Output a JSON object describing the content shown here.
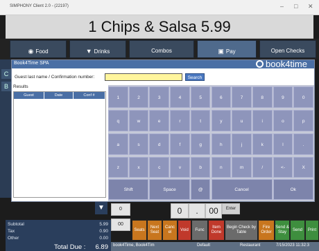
{
  "window": {
    "title": "SIMPHONY Client 2.0 - (22197)"
  },
  "order": {
    "line": "1 Chips & Salsa 5.99"
  },
  "tabs": [
    {
      "label": "Food",
      "icon": "burger-icon"
    },
    {
      "label": "Drinks",
      "icon": "glass-icon"
    },
    {
      "label": "Combos",
      "icon": ""
    },
    {
      "label": "Pay",
      "icon": "register-icon"
    },
    {
      "label": "Open Checks",
      "icon": ""
    }
  ],
  "dialog": {
    "title": "Book4Time SPA",
    "logo_text": "book4time",
    "guest_label": "Guest last name / Confirmation number:",
    "guest_value": "",
    "search_label": "Search",
    "results_label": "Results",
    "columns": [
      "Guest",
      "Date",
      "Conf #"
    ]
  },
  "keyboard": {
    "row1": [
      "1",
      "2",
      "3",
      "4",
      "5",
      "6",
      "7",
      "8",
      "9",
      "0"
    ],
    "row2": [
      "q",
      "w",
      "e",
      "r",
      "t",
      "y",
      "u",
      "i",
      "o",
      "p"
    ],
    "row3": [
      "a",
      "s",
      "d",
      "f",
      "g",
      "h",
      "j",
      "k",
      "l",
      "."
    ],
    "row4": [
      "z",
      "x",
      "c",
      "v",
      "b",
      "n",
      "m",
      "/",
      "<-",
      "X"
    ],
    "row5": [
      "Shift",
      "Space",
      "@",
      "Cancel",
      "Ok"
    ]
  },
  "totals": {
    "subtotal_label": "Subtotal",
    "subtotal": "5.99",
    "tax_label": "Tax",
    "tax": "0.90",
    "other_label": "Other",
    "other": "0.00",
    "total_due_label": "Total Due :",
    "total_due": "6.89"
  },
  "numpad": {
    "field1": "0",
    "field2": "00",
    "field3": "0",
    "field4": ".",
    "field5": "00",
    "enter_label": "Enter"
  },
  "actions": [
    {
      "label": "Seats",
      "color": "#c8761e"
    },
    {
      "label": "Next Seat",
      "color": "#c8761e"
    },
    {
      "label": "Canc el",
      "color": "#c8761e"
    },
    {
      "label": "Void",
      "color": "#c0392b"
    },
    {
      "label": "Func",
      "color": "#6b6b6b"
    },
    {
      "label": "Item Done",
      "color": "#c0392b"
    },
    {
      "label": "Begin Check by Table",
      "color": "#6b6b6b"
    },
    {
      "label": "Fire Order",
      "color": "#c8761e"
    },
    {
      "label": "Send & Stay",
      "color": "#3e8e3e"
    },
    {
      "label": "Send",
      "color": "#3e8e3e"
    },
    {
      "label": "Print",
      "color": "#3e8e3e"
    }
  ],
  "statusbar": {
    "app": "book4Time, Book4Tim",
    "mode": "Default",
    "location": "Restaurant",
    "datetime": "7/15/2023 11:32:3"
  }
}
